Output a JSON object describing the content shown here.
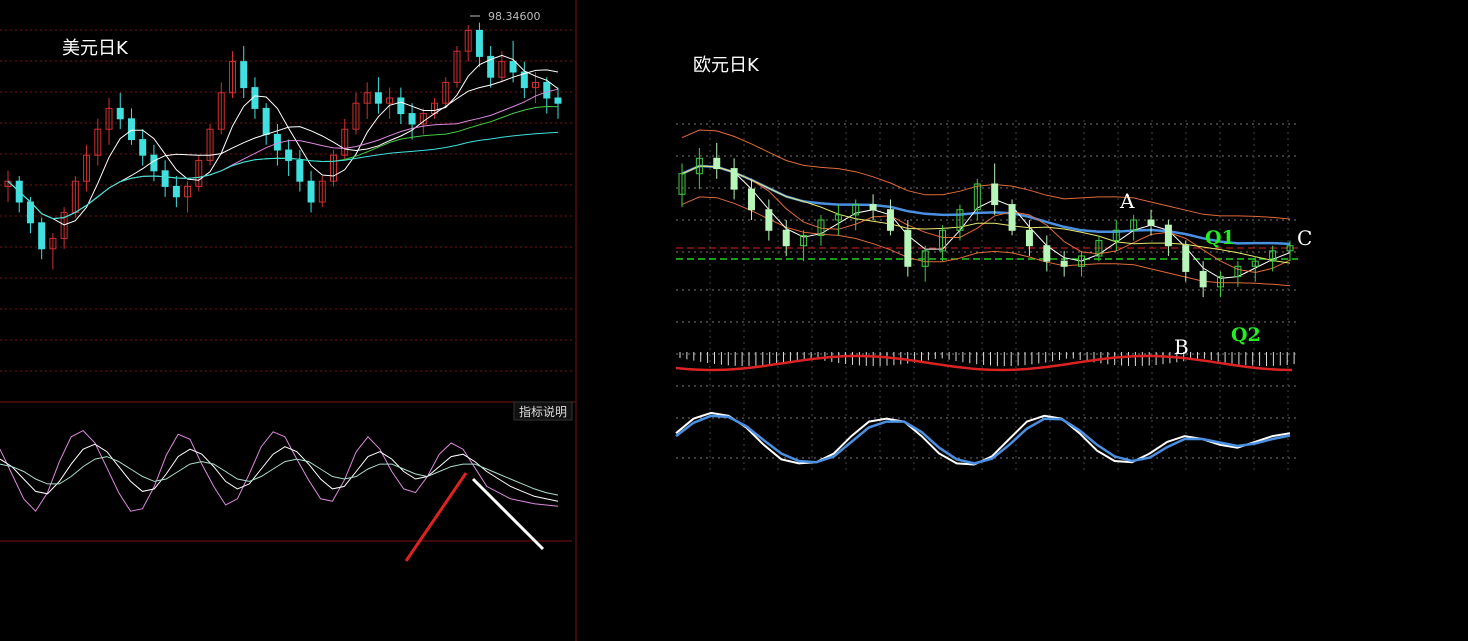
{
  "usd_panel": {
    "title": "美元日K",
    "peak_label": "98.34600",
    "indicator_button": "指标说明"
  },
  "eur_panel": {
    "title": "欧元日K",
    "labels": {
      "A": "A",
      "B": "B",
      "C": "C",
      "Q1": "Q1",
      "Q2": "Q2"
    }
  },
  "colors": {
    "up": "#d03030",
    "down": "#40e0e0",
    "eur_candle": "#b8f5b8",
    "grid_red": "#7a1212",
    "grid_gray": "#777777",
    "ma_blue": "#4a90e2",
    "ma_green": "#44cc44",
    "ma_pink": "#dd88dd",
    "band_orange": "#e06a3a",
    "red_line": "#dd2222",
    "green_dash": "#22cc22"
  },
  "chart_data": [
    {
      "type": "candlestick",
      "title": "美元日K",
      "annotation": "98.34600",
      "ohlc": [
        [
          95.2,
          95.5,
          94.9,
          95.3
        ],
        [
          95.3,
          95.4,
          94.7,
          94.9
        ],
        [
          94.9,
          95.0,
          94.3,
          94.5
        ],
        [
          94.5,
          94.6,
          93.8,
          94.0
        ],
        [
          94.0,
          94.3,
          93.6,
          94.2
        ],
        [
          94.2,
          94.8,
          94.0,
          94.7
        ],
        [
          94.7,
          95.4,
          94.6,
          95.3
        ],
        [
          95.3,
          96.0,
          95.1,
          95.8
        ],
        [
          95.8,
          96.5,
          95.6,
          96.3
        ],
        [
          96.3,
          96.9,
          96.0,
          96.7
        ],
        [
          96.7,
          97.0,
          96.3,
          96.5
        ],
        [
          96.5,
          96.7,
          96.0,
          96.1
        ],
        [
          96.1,
          96.3,
          95.6,
          95.8
        ],
        [
          95.8,
          96.0,
          95.3,
          95.5
        ],
        [
          95.5,
          95.7,
          95.0,
          95.2
        ],
        [
          95.2,
          95.4,
          94.8,
          95.0
        ],
        [
          95.0,
          95.3,
          94.7,
          95.2
        ],
        [
          95.2,
          95.8,
          95.1,
          95.7
        ],
        [
          95.7,
          96.4,
          95.6,
          96.3
        ],
        [
          96.3,
          97.2,
          96.2,
          97.0
        ],
        [
          97.0,
          97.8,
          96.9,
          97.6
        ],
        [
          97.6,
          97.9,
          96.9,
          97.1
        ],
        [
          97.1,
          97.3,
          96.5,
          96.7
        ],
        [
          96.7,
          96.8,
          96.0,
          96.2
        ],
        [
          96.2,
          96.4,
          95.6,
          95.9
        ],
        [
          95.9,
          96.1,
          95.4,
          95.7
        ],
        [
          95.7,
          95.9,
          95.1,
          95.3
        ],
        [
          95.3,
          95.5,
          94.7,
          94.9
        ],
        [
          94.9,
          95.4,
          94.8,
          95.3
        ],
        [
          95.3,
          95.9,
          95.2,
          95.8
        ],
        [
          95.8,
          96.5,
          95.7,
          96.3
        ],
        [
          96.3,
          97.0,
          96.2,
          96.8
        ],
        [
          96.8,
          97.2,
          96.5,
          97.0
        ],
        [
          97.0,
          97.3,
          96.6,
          96.8
        ],
        [
          96.8,
          97.1,
          96.5,
          96.9
        ],
        [
          96.9,
          97.1,
          96.4,
          96.6
        ],
        [
          96.6,
          96.8,
          96.1,
          96.4
        ],
        [
          96.4,
          96.7,
          96.2,
          96.6
        ],
        [
          96.6,
          96.9,
          96.5,
          96.8
        ],
        [
          96.8,
          97.3,
          96.7,
          97.2
        ],
        [
          97.2,
          97.9,
          97.1,
          97.8
        ],
        [
          97.8,
          98.3,
          97.6,
          98.2
        ],
        [
          98.2,
          98.35,
          97.5,
          97.7
        ],
        [
          97.7,
          97.9,
          97.1,
          97.3
        ],
        [
          97.3,
          97.8,
          97.2,
          97.6
        ],
        [
          97.6,
          98.0,
          97.2,
          97.4
        ],
        [
          97.4,
          97.6,
          96.9,
          97.1
        ],
        [
          97.1,
          97.4,
          96.8,
          97.2
        ],
        [
          97.2,
          97.3,
          96.6,
          96.9
        ],
        [
          96.9,
          97.1,
          96.5,
          96.8
        ]
      ],
      "indicator": {
        "series": [
          {
            "values": [
              70,
              50,
              30,
              20,
              35,
              60,
              80,
              85,
              75,
              55,
              35,
              20,
              22,
              40,
              65,
              82,
              78,
              58,
              40,
              25,
              30,
              50,
              72,
              84,
              80,
              62,
              45,
              30,
              28,
              45,
              68,
              80,
              70,
              52,
              38,
              35,
              48,
              66,
              75,
              70,
              55,
              40,
              35,
              30,
              28,
              26,
              25,
              24
            ]
          },
          {
            "values": [
              62,
              56,
              46,
              36,
              34,
              44,
              58,
              70,
              74,
              68,
              56,
              44,
              36,
              38,
              50,
              64,
              70,
              66,
              56,
              44,
              38,
              42,
              54,
              66,
              72,
              68,
              58,
              46,
              38,
              40,
              52,
              64,
              68,
              62,
              52,
              46,
              48,
              56,
              64,
              66,
              60,
              52,
              46,
              40,
              36,
              32,
              30,
              28
            ]
          },
          {
            "values": [
              58,
              56,
              52,
              46,
              42,
              42,
              48,
              56,
              62,
              64,
              60,
              54,
              48,
              44,
              46,
              52,
              58,
              60,
              58,
              52,
              46,
              44,
              48,
              54,
              60,
              62,
              60,
              54,
              48,
              46,
              48,
              54,
              58,
              58,
              54,
              50,
              48,
              52,
              56,
              58,
              58,
              54,
              50,
              46,
              42,
              38,
              35,
              33
            ]
          }
        ],
        "ylim": [
          0,
          100
        ]
      }
    },
    {
      "type": "candlestick",
      "title": "欧元日K",
      "annotations": [
        "A",
        "B",
        "C",
        "Q1",
        "Q2"
      ],
      "ohlc": [
        [
          1.12,
          1.132,
          1.115,
          1.128
        ],
        [
          1.128,
          1.138,
          1.122,
          1.134
        ],
        [
          1.134,
          1.14,
          1.126,
          1.13
        ],
        [
          1.13,
          1.134,
          1.118,
          1.122
        ],
        [
          1.122,
          1.126,
          1.11,
          1.114
        ],
        [
          1.114,
          1.118,
          1.102,
          1.106
        ],
        [
          1.106,
          1.11,
          1.096,
          1.1
        ],
        [
          1.1,
          1.106,
          1.094,
          1.104
        ],
        [
          1.104,
          1.112,
          1.1,
          1.11
        ],
        [
          1.11,
          1.116,
          1.104,
          1.112
        ],
        [
          1.112,
          1.118,
          1.106,
          1.116
        ],
        [
          1.116,
          1.12,
          1.11,
          1.114
        ],
        [
          1.114,
          1.118,
          1.104,
          1.106
        ],
        [
          1.106,
          1.11,
          1.088,
          1.092
        ],
        [
          1.092,
          1.1,
          1.086,
          1.098
        ],
        [
          1.098,
          1.108,
          1.094,
          1.106
        ],
        [
          1.106,
          1.116,
          1.102,
          1.114
        ],
        [
          1.114,
          1.126,
          1.11,
          1.124
        ],
        [
          1.124,
          1.132,
          1.112,
          1.116
        ],
        [
          1.116,
          1.118,
          1.104,
          1.106
        ],
        [
          1.106,
          1.11,
          1.096,
          1.1
        ],
        [
          1.1,
          1.104,
          1.09,
          1.094
        ],
        [
          1.094,
          1.098,
          1.088,
          1.092
        ],
        [
          1.092,
          1.098,
          1.088,
          1.096
        ],
        [
          1.096,
          1.104,
          1.094,
          1.102
        ],
        [
          1.102,
          1.11,
          1.098,
          1.106
        ],
        [
          1.106,
          1.112,
          1.102,
          1.11
        ],
        [
          1.11,
          1.114,
          1.104,
          1.108
        ],
        [
          1.108,
          1.11,
          1.096,
          1.1
        ],
        [
          1.1,
          1.102,
          1.086,
          1.09
        ],
        [
          1.09,
          1.094,
          1.08,
          1.084
        ],
        [
          1.084,
          1.09,
          1.08,
          1.088
        ],
        [
          1.088,
          1.094,
          1.084,
          1.092
        ],
        [
          1.092,
          1.096,
          1.086,
          1.094
        ],
        [
          1.094,
          1.1,
          1.09,
          1.098
        ],
        [
          1.098,
          1.102,
          1.094,
          1.1
        ]
      ],
      "sub_indicator": {
        "series": [
          {
            "values": [
              60,
              85,
              95,
              90,
              70,
              40,
              15,
              8,
              10,
              25,
              55,
              80,
              85,
              80,
              55,
              25,
              8,
              6,
              20,
              50,
              80,
              90,
              85,
              60,
              30,
              12,
              10,
              25,
              45,
              55,
              50,
              40,
              35,
              45,
              55,
              60
            ]
          },
          {
            "values": [
              55,
              78,
              90,
              88,
              72,
              48,
              25,
              12,
              10,
              20,
              45,
              70,
              80,
              80,
              62,
              35,
              15,
              8,
              16,
              40,
              68,
              85,
              84,
              65,
              40,
              20,
              12,
              18,
              36,
              50,
              50,
              44,
              38,
              42,
              50,
              56
            ]
          }
        ],
        "ylim": [
          0,
          100
        ]
      }
    }
  ]
}
